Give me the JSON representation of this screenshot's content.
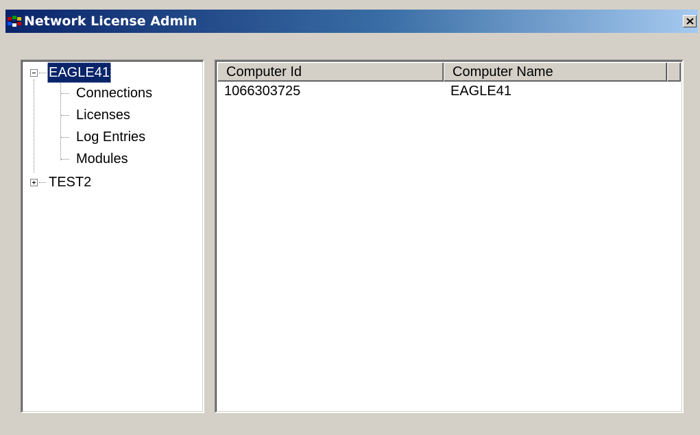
{
  "window": {
    "title": "Network License Admin",
    "close_glyph": "✕"
  },
  "tree": {
    "root_nodes": [
      {
        "label": "EAGLE41",
        "expanded": true,
        "selected": true,
        "children": [
          "Connections",
          "Licenses",
          "Log Entries",
          "Modules"
        ]
      },
      {
        "label": "TEST2",
        "expanded": false,
        "selected": false
      }
    ]
  },
  "list": {
    "columns": [
      "Computer Id",
      "Computer Name"
    ],
    "rows": [
      [
        "1066303725",
        "EAGLE41"
      ]
    ]
  },
  "colors": {
    "title_gradient_start": "#0a246a",
    "title_gradient_end": "#a6caf0",
    "selection": "#0a246a",
    "face": "#d4d0c8"
  }
}
